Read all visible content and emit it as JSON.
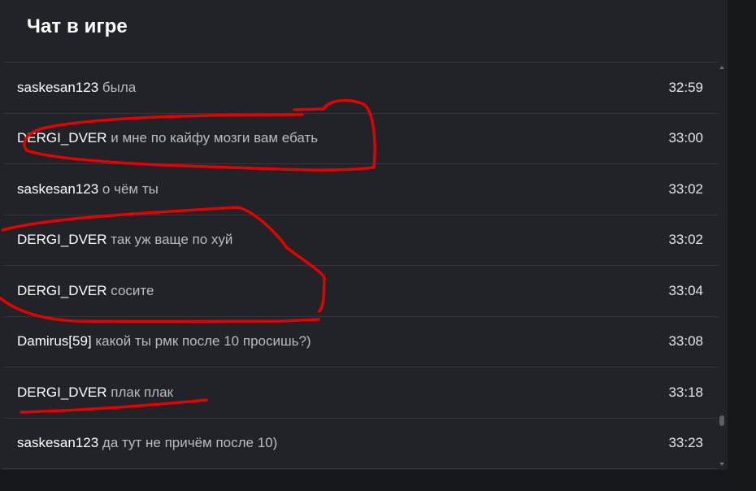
{
  "chat": {
    "title": "Чат в игре",
    "messages": [
      {
        "author": "saskesan123",
        "text": "была",
        "time": "32:59"
      },
      {
        "author": "DERGI_DVER",
        "text": "и мне по кайфу мозги вам ебать",
        "time": "33:00"
      },
      {
        "author": "saskesan123",
        "text": "о чём ты",
        "time": "33:02"
      },
      {
        "author": "DERGI_DVER",
        "text": "так уж ваще по хуй",
        "time": "33:02"
      },
      {
        "author": "DERGI_DVER",
        "text": "сосите",
        "time": "33:04"
      },
      {
        "author": "Damirus[59]",
        "text": "какой ты рмк после 10 просишь?)",
        "time": "33:08"
      },
      {
        "author": "DERGI_DVER",
        "text": "плак плак",
        "time": "33:18"
      },
      {
        "author": "saskesan123",
        "text": "да тут не причём после 10)",
        "time": "33:23"
      }
    ]
  },
  "colors": {
    "panel_background": "#212328",
    "page_background": "#16171b",
    "author_text": "#ffffff",
    "message_text": "#b9bbc2",
    "annotation": "#e50000"
  },
  "icons": {
    "scroll_up": "scroll-up-arrow-icon",
    "scroll_down": "scroll-down-arrow-icon"
  }
}
